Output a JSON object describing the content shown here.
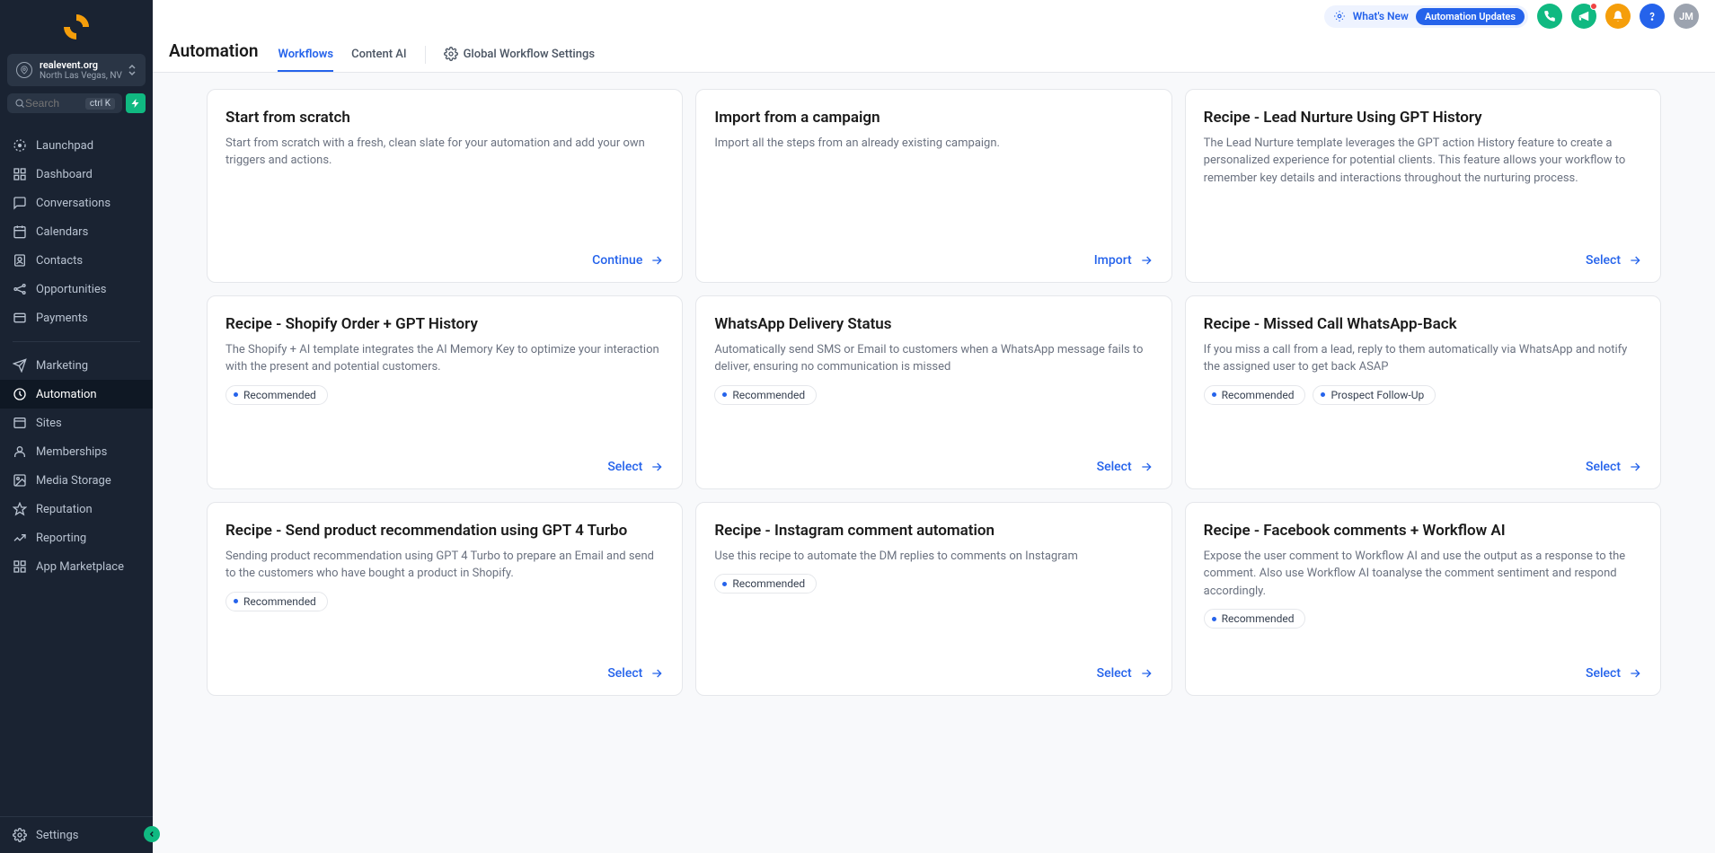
{
  "account": {
    "name": "realevent.org",
    "location": "North Las Vegas, NV"
  },
  "search": {
    "placeholder": "Search",
    "shortcut": "ctrl K"
  },
  "nav": {
    "items": [
      {
        "label": "Launchpad",
        "icon": "launchpad"
      },
      {
        "label": "Dashboard",
        "icon": "dashboard"
      },
      {
        "label": "Conversations",
        "icon": "chat"
      },
      {
        "label": "Calendars",
        "icon": "calendar"
      },
      {
        "label": "Contacts",
        "icon": "contacts"
      },
      {
        "label": "Opportunities",
        "icon": "opportunities"
      },
      {
        "label": "Payments",
        "icon": "payments"
      },
      {
        "label": "Marketing",
        "icon": "marketing"
      },
      {
        "label": "Automation",
        "icon": "automation"
      },
      {
        "label": "Sites",
        "icon": "sites"
      },
      {
        "label": "Memberships",
        "icon": "memberships"
      },
      {
        "label": "Media Storage",
        "icon": "media"
      },
      {
        "label": "Reputation",
        "icon": "star"
      },
      {
        "label": "Reporting",
        "icon": "reporting"
      },
      {
        "label": "App Marketplace",
        "icon": "apps"
      }
    ],
    "settings": "Settings"
  },
  "topbar": {
    "whats_new": "What's New",
    "auto_updates": "Automation Updates",
    "avatar": "JM"
  },
  "page": {
    "title": "Automation",
    "tabs": [
      {
        "label": "Workflows",
        "active": true
      },
      {
        "label": "Content AI",
        "active": false
      },
      {
        "label": "Global Workflow Settings",
        "active": false,
        "icon": true
      }
    ]
  },
  "cards": [
    {
      "title": "Start from scratch",
      "desc": "Start from scratch with a fresh, clean slate for your automation and add your own triggers and actions.",
      "action": "Continue",
      "tags": []
    },
    {
      "title": "Import from a campaign",
      "desc": "Import all the steps from an already existing campaign.",
      "action": "Import",
      "tags": []
    },
    {
      "title": "Recipe - Lead Nurture Using GPT History",
      "desc": "The Lead Nurture template leverages the GPT action History feature to create a personalized experience for potential clients. This feature allows your workflow to remember key details and interactions throughout the nurturing process.",
      "action": "Select",
      "tags": []
    },
    {
      "title": "Recipe - Shopify Order + GPT History",
      "desc": "The Shopify + AI template integrates the AI Memory Key to optimize your interaction with the present and potential customers.",
      "action": "Select",
      "tags": [
        "Recommended"
      ]
    },
    {
      "title": "WhatsApp Delivery Status",
      "desc": "Automatically send SMS or Email to customers when a WhatsApp message fails to deliver, ensuring no communication is missed",
      "action": "Select",
      "tags": [
        "Recommended"
      ]
    },
    {
      "title": "Recipe - Missed Call WhatsApp-Back",
      "desc": "If you miss a call from a lead, reply to them automatically via WhatsApp and notify the assigned user to get back ASAP",
      "action": "Select",
      "tags": [
        "Recommended",
        "Prospect Follow-Up"
      ]
    },
    {
      "title": "Recipe - Send product recommendation using GPT 4 Turbo",
      "desc": "Sending product recommendation using GPT 4 Turbo to prepare an Email and send to the customers who have bought a product in Shopify.",
      "action": "Select",
      "tags": [
        "Recommended"
      ]
    },
    {
      "title": "Recipe - Instagram comment automation",
      "desc": "Use this recipe to automate the DM replies to comments on Instagram",
      "action": "Select",
      "tags": [
        "Recommended"
      ]
    },
    {
      "title": "Recipe - Facebook comments + Workflow AI",
      "desc": "Expose the user comment to Workflow AI and use the output as a response to the comment. Also use Workflow AI toanalyse the comment sentiment and respond accordingly.",
      "action": "Select",
      "tags": [
        "Recommended"
      ]
    }
  ]
}
